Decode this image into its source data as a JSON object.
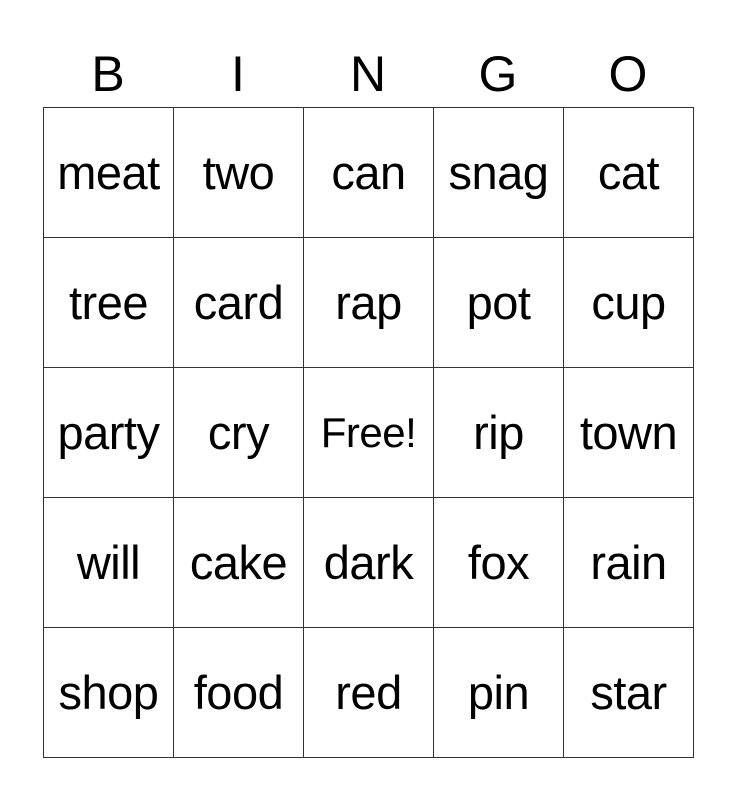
{
  "header": [
    "B",
    "I",
    "N",
    "G",
    "O"
  ],
  "rows": [
    [
      "meat",
      "two",
      "can",
      "snag",
      "cat"
    ],
    [
      "tree",
      "card",
      "rap",
      "pot",
      "cup"
    ],
    [
      "party",
      "cry",
      "Free!",
      "rip",
      "town"
    ],
    [
      "will",
      "cake",
      "dark",
      "fox",
      "rain"
    ],
    [
      "shop",
      "food",
      "red",
      "pin",
      "star"
    ]
  ],
  "free_cell": {
    "row": 2,
    "col": 2
  }
}
